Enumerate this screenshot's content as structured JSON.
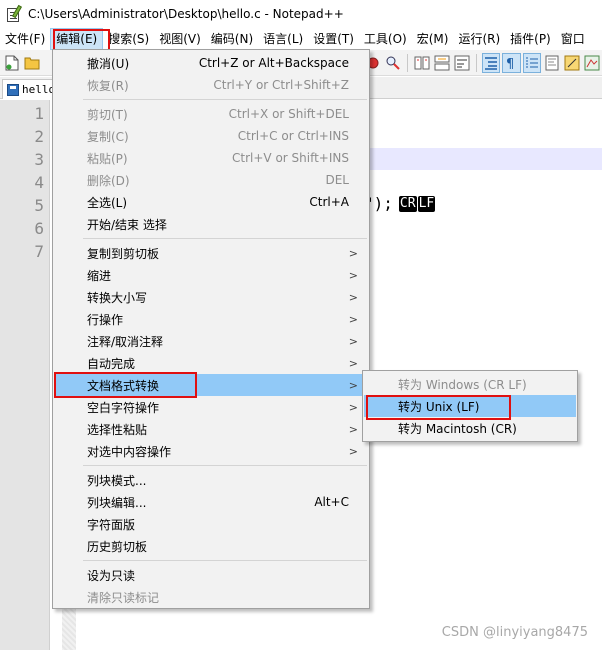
{
  "window": {
    "title": "C:\\Users\\Administrator\\Desktop\\hello.c - Notepad++"
  },
  "menubar": {
    "items": [
      "文件(F)",
      "编辑(E)",
      "搜索(S)",
      "视图(V)",
      "编码(N)",
      "语言(L)",
      "设置(T)",
      "工具(O)",
      "宏(M)",
      "运行(R)",
      "插件(P)",
      "窗口"
    ]
  },
  "tabs": [
    {
      "label": "hello.c"
    }
  ],
  "editor": {
    "line_numbers": [
      "1",
      "2",
      "3",
      "4",
      "5",
      "6",
      "7"
    ],
    "visible_code_fragment": "\");",
    "eol_markers": [
      "CR",
      "LF"
    ]
  },
  "edit_menu": {
    "items": [
      {
        "label": "撤消(U)",
        "shortcut": "Ctrl+Z or Alt+Backspace",
        "enabled": true
      },
      {
        "label": "恢复(R)",
        "shortcut": "Ctrl+Y or Ctrl+Shift+Z",
        "enabled": false
      },
      {
        "label": "剪切(T)",
        "shortcut": "Ctrl+X or Shift+DEL",
        "enabled": false
      },
      {
        "label": "复制(C)",
        "shortcut": "Ctrl+C or Ctrl+INS",
        "enabled": false
      },
      {
        "label": "粘贴(P)",
        "shortcut": "Ctrl+V or Shift+INS",
        "enabled": false
      },
      {
        "label": "删除(D)",
        "shortcut": "DEL",
        "enabled": false
      },
      {
        "label": "全选(L)",
        "shortcut": "Ctrl+A",
        "enabled": true
      },
      {
        "label": "开始/结束 选择",
        "shortcut": "",
        "enabled": true
      },
      {
        "label": "复制到剪切板",
        "submenu": true,
        "enabled": true
      },
      {
        "label": "缩进",
        "submenu": true,
        "enabled": true
      },
      {
        "label": "转换大小写",
        "submenu": true,
        "enabled": true
      },
      {
        "label": "行操作",
        "submenu": true,
        "enabled": true
      },
      {
        "label": "注释/取消注释",
        "submenu": true,
        "enabled": true
      },
      {
        "label": "自动完成",
        "submenu": true,
        "enabled": true
      },
      {
        "label": "文档格式转换",
        "submenu": true,
        "enabled": true,
        "highlighted": true
      },
      {
        "label": "空白字符操作",
        "submenu": true,
        "enabled": true
      },
      {
        "label": "选择性粘贴",
        "submenu": true,
        "enabled": true
      },
      {
        "label": "对选中内容操作",
        "submenu": true,
        "enabled": true
      },
      {
        "label": "列块模式...",
        "shortcut": "",
        "enabled": true
      },
      {
        "label": "列块编辑...",
        "shortcut": "Alt+C",
        "enabled": true
      },
      {
        "label": "字符面版",
        "shortcut": "",
        "enabled": true
      },
      {
        "label": "历史剪切板",
        "shortcut": "",
        "enabled": true
      },
      {
        "label": "设为只读",
        "shortcut": "",
        "enabled": true
      },
      {
        "label": "清除只读标记",
        "shortcut": "",
        "enabled": false
      }
    ]
  },
  "eol_submenu": {
    "items": [
      {
        "label": "转为 Windows (CR LF)",
        "enabled": false
      },
      {
        "label": "转为 Unix (LF)",
        "enabled": true,
        "highlighted": true
      },
      {
        "label": "转为 Macintosh (CR)",
        "enabled": true
      }
    ]
  },
  "watermark": "CSDN @linyiyang8475",
  "colors": {
    "highlight": "#91c9f7",
    "annotation_red": "#e01010",
    "current_line": "#e8e8ff",
    "menu_bg": "#f2f2f2"
  }
}
